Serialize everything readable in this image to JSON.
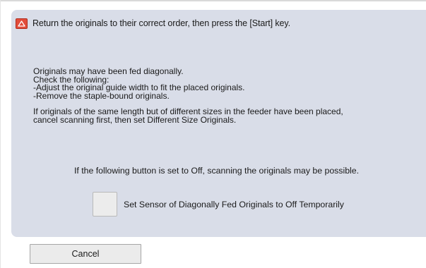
{
  "header": {
    "icon": "warning-triangle-icon",
    "icon_color": "#e24d3b",
    "message": "Return the originals to their correct order, then press the [Start] key."
  },
  "body": {
    "lines_1": [
      "Originals may have been fed diagonally.",
      "Check the following:",
      "-Adjust the original guide width to fit the placed originals.",
      "-Remove the staple-bound originals."
    ],
    "lines_2": [
      "If originals of the same length but of different sizes in the feeder have been placed,",
      "cancel scanning first, then set Different Size Originals."
    ],
    "off_note": "If the following button is set to Off, scanning the originals may be possible."
  },
  "sensor_toggle": {
    "label": "Set Sensor of Diagonally Fed Originals to Off Temporarily"
  },
  "footer": {
    "cancel_label": "Cancel"
  },
  "colors": {
    "panel_background": "#d9dde8",
    "button_background": "#ebebeb"
  }
}
